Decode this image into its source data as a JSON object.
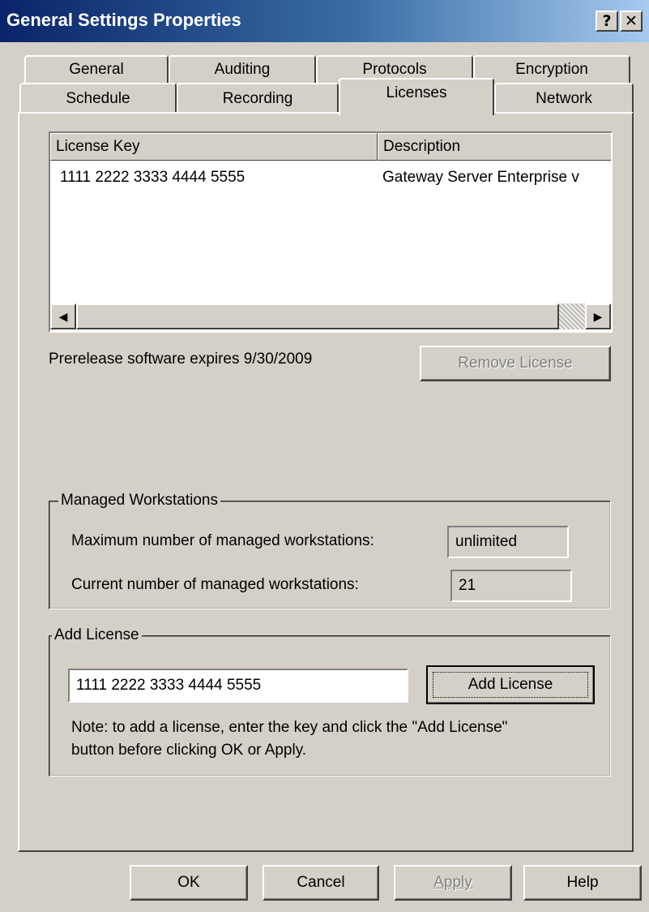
{
  "window": {
    "title": "General Settings Properties",
    "help_glyph": "?",
    "close_glyph": "✕"
  },
  "tabs": {
    "row1": [
      "General",
      "Auditing",
      "Protocols",
      "Encryption"
    ],
    "row2": [
      "Schedule",
      "Recording",
      "Licenses",
      "Network"
    ],
    "active": "Licenses"
  },
  "license_list": {
    "columns": [
      "License Key",
      "Description"
    ],
    "rows": [
      {
        "key": "1111 2222 3333 4444 5555",
        "description": "Gateway Server Enterprise v"
      }
    ],
    "scroll_left_glyph": "◀",
    "scroll_right_glyph": "▶"
  },
  "status_text": "Prerelease software expires 9/30/2009",
  "remove_license_label": "Remove License",
  "managed_workstations": {
    "legend": "Managed Workstations",
    "max_label": "Maximum number of managed workstations:",
    "max_value": "unlimited",
    "current_label": "Current number of managed workstations:",
    "current_value": "21"
  },
  "add_license": {
    "legend": "Add License",
    "input_value": "1111 2222 3333 4444 5555",
    "button_label": "Add License",
    "note_line1": "Note: to add a license, enter the key and click the \"Add License\"",
    "note_line2": "button before clicking OK or Apply."
  },
  "footer": {
    "ok": "OK",
    "cancel": "Cancel",
    "apply": "Apply",
    "help": "Help"
  }
}
